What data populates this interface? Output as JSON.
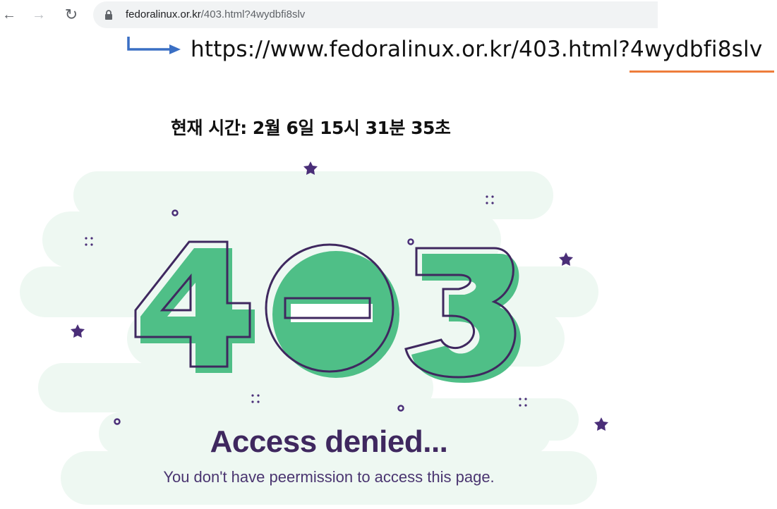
{
  "browser": {
    "url_host": "fedoralinux.or.kr",
    "url_path": "/403.html?4wydbfi8slv",
    "nav": {
      "back_icon": "arrow-left-icon",
      "forward_icon": "arrow-right-icon",
      "reload_icon": "reload-icon",
      "lock_icon": "lock-icon"
    }
  },
  "annotation": {
    "full_url": "https://www.fedoralinux.or.kr/403.html?4wydbfi8slv",
    "arrow_color": "#3a6fc4",
    "underline_color": "#ee7d3b"
  },
  "page": {
    "current_time": "현재 시간: 2월 6일 15시 31분 35초",
    "error_code": "403",
    "title": "Access denied...",
    "message": "You don't have peermission to access this page."
  },
  "colors": {
    "green": "#4fbf87",
    "purple": "#3f285f",
    "cloud": "#eef8f2"
  }
}
